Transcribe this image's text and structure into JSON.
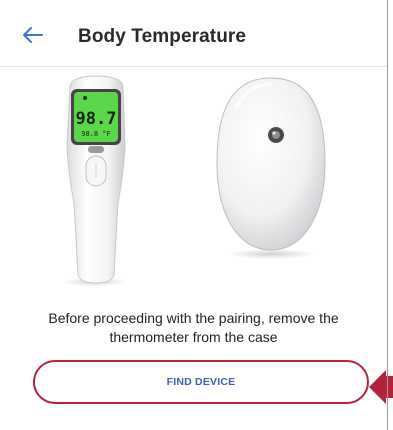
{
  "header": {
    "back_icon": "arrow-left-icon",
    "title": "Body Temperature"
  },
  "thermometer": {
    "display_main": "98.7",
    "display_sub": "98.8 °F"
  },
  "message": "Before proceeding with the pairing, remove the thermometer from the case",
  "find_button": {
    "label": "FIND DEVICE"
  },
  "colors": {
    "accent": "#3a78d6",
    "button_border": "#b3243c",
    "button_text": "#3a5fb3",
    "annotation_arrow": "#b3243c",
    "display": "#5bd84a"
  }
}
